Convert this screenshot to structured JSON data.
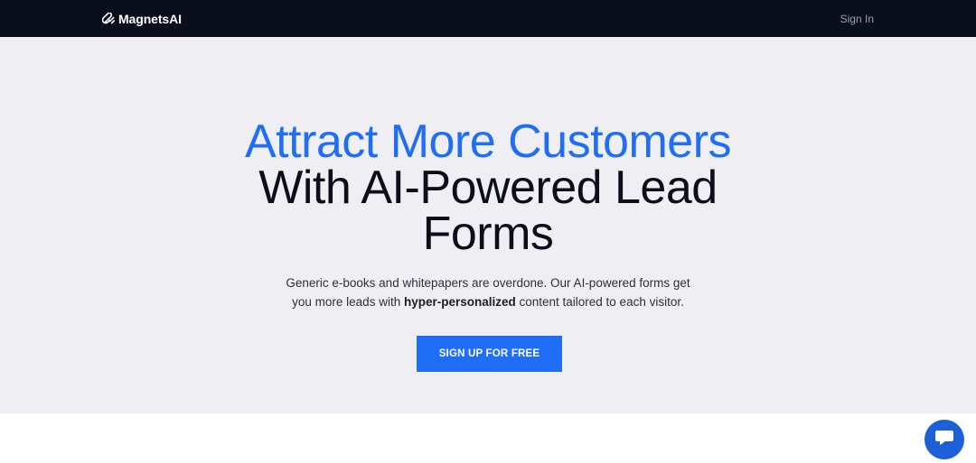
{
  "header": {
    "brand_name": "MagnetsAI",
    "brand_icon": "magnet-icon",
    "signin_label": "Sign In"
  },
  "hero": {
    "headline_accent": "Attract More Customers",
    "headline_line2": "With AI-Powered Lead",
    "headline_line3": "Forms",
    "subtext_part1": "Generic e-books and whitepapers are overdone. Our AI-powered forms get",
    "subtext_part2": "you more leads with ",
    "subtext_bold": "hyper-personalized",
    "subtext_part3": " content tailored to each visitor.",
    "cta_label": "SIGN UP FOR FREE"
  },
  "chat": {
    "icon": "chat-bubble-icon"
  },
  "colors": {
    "accent": "#1f6ef5",
    "topbar": "#0b0f1c",
    "hero_bg": "#efeff3",
    "chat": "#1d5fd6"
  }
}
